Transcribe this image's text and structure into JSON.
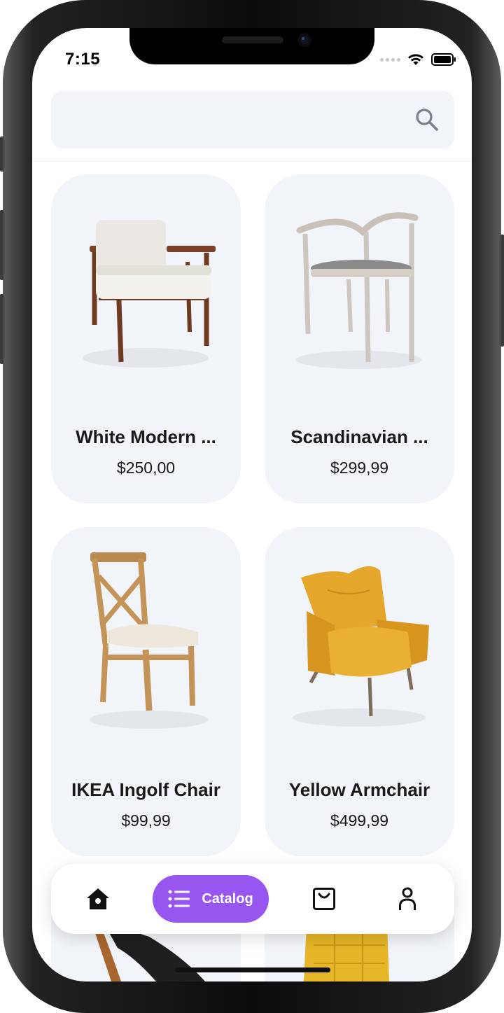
{
  "status_bar": {
    "time": "7:15"
  },
  "search": {
    "placeholder": "",
    "value": ""
  },
  "products": [
    {
      "name": "White Modern ...",
      "price": "$250,00"
    },
    {
      "name": "Scandinavian ...",
      "price": "$299,99"
    },
    {
      "name": "IKEA Ingolf Chair",
      "price": "$99,99"
    },
    {
      "name": "Yellow Armchair",
      "price": "$499,99"
    }
  ],
  "bottom_nav": {
    "items": [
      {
        "icon": "home-icon",
        "label": ""
      },
      {
        "icon": "list-icon",
        "label": "Catalog",
        "active": true
      },
      {
        "icon": "bag-icon",
        "label": ""
      },
      {
        "icon": "person-icon",
        "label": ""
      }
    ]
  },
  "colors": {
    "accent": "#9756f0",
    "card_bg": "#f1f4f8"
  }
}
